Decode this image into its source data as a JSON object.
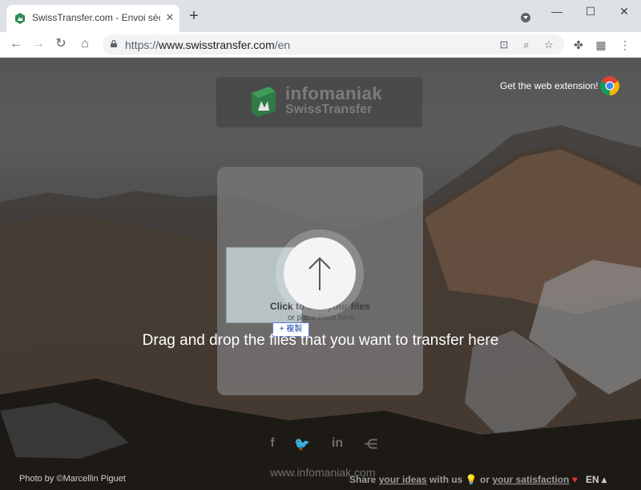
{
  "browser": {
    "tab_title": "SwissTransfer.com - Envoi sécurisé",
    "tab_close": "✕",
    "new_tab": "+",
    "window_controls": {
      "minimize": "—",
      "maximize": "☐",
      "close": "✕"
    },
    "url_prefix": "https://",
    "url_host": "www.swisstransfer.com",
    "url_path": "/en"
  },
  "header": {
    "logo_name": "infomaniak",
    "logo_sub": "SwissTransfer",
    "web_extension_label": "Get the web extension!"
  },
  "upload": {
    "click_label": "Click to add your files",
    "place_label": "or place them here",
    "copy_badge": "+ 複製",
    "drag_label": "Drag and drop the files that you want to transfer here"
  },
  "social": {
    "facebook": "f",
    "twitter": "🐦",
    "linkedin": "in",
    "share": "⋲"
  },
  "footer": {
    "domain": "www.infomaniak.com",
    "photo_credit": "Photo by ©Marcellin Piguet",
    "share_prefix": "Share ",
    "share_link": "your ideas",
    "share_mid": " with us ",
    "or_text": " or ",
    "satisfaction_link": "your satisfaction",
    "language": "EN ▴"
  },
  "colors": {
    "logo_green": "#2e8b57",
    "chrome_red": "#db4437",
    "chrome_yellow": "#f4b400",
    "chrome_green": "#0f9d58",
    "chrome_blue": "#4285f4"
  }
}
